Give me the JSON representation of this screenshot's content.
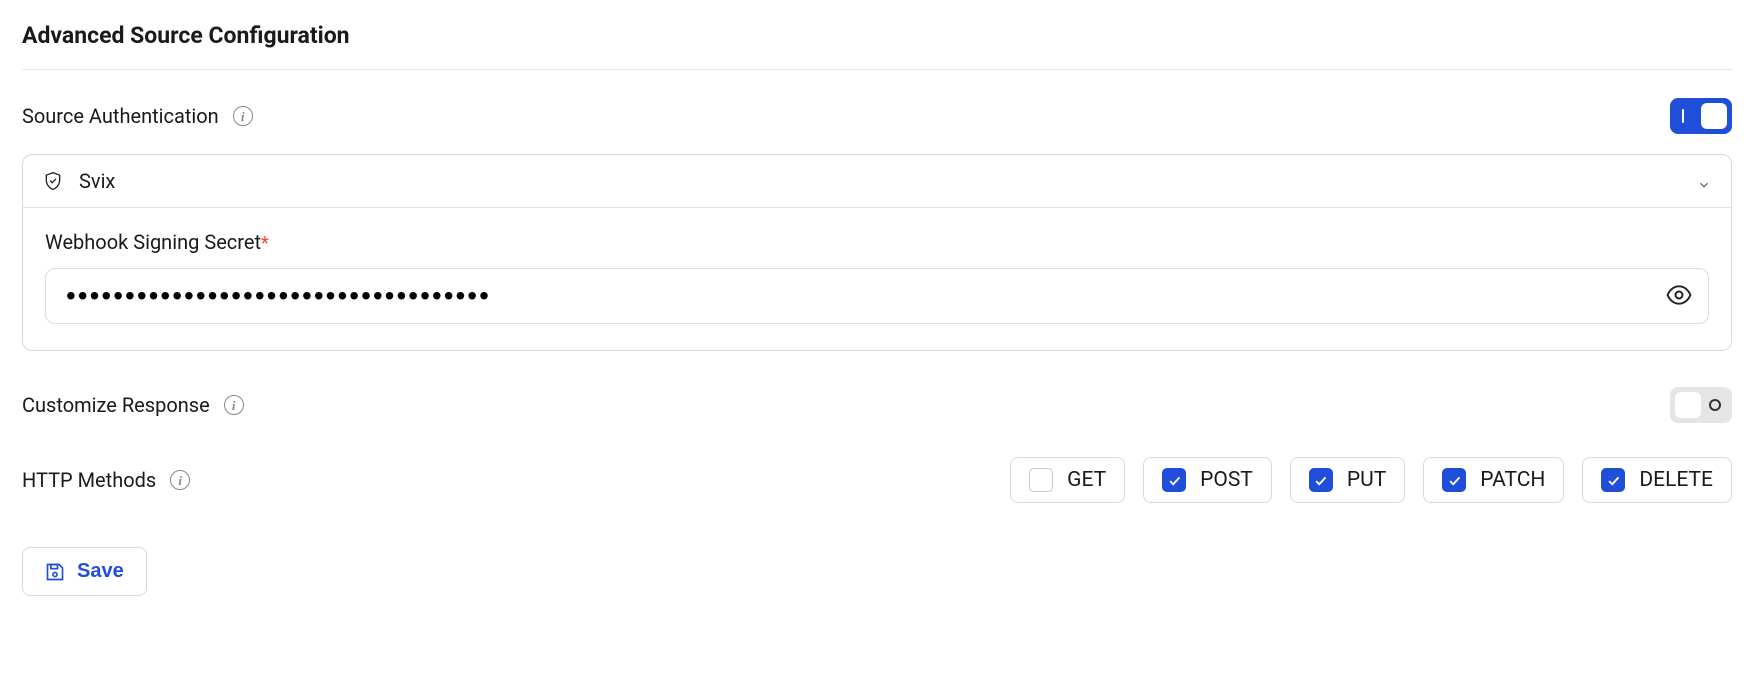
{
  "title": "Advanced Source Configuration",
  "sourceAuth": {
    "label": "Source Authentication",
    "enabled": true,
    "provider": "Svix",
    "secret": {
      "label": "Webhook Signing Secret",
      "requiredMark": "*",
      "value": "••••••••••••••••••••••••••••••••••••"
    }
  },
  "customizeResponse": {
    "label": "Customize Response",
    "enabled": false
  },
  "httpMethods": {
    "label": "HTTP Methods",
    "options": [
      {
        "name": "GET",
        "checked": false
      },
      {
        "name": "POST",
        "checked": true
      },
      {
        "name": "PUT",
        "checked": true
      },
      {
        "name": "PATCH",
        "checked": true
      },
      {
        "name": "DELETE",
        "checked": true
      }
    ]
  },
  "saveLabel": "Save"
}
